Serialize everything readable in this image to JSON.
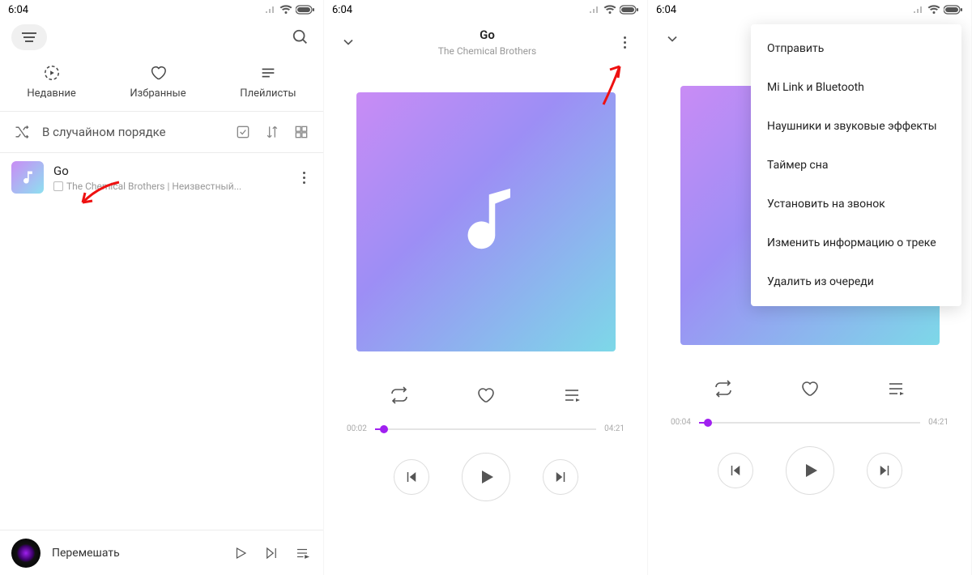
{
  "status": {
    "time": "6:04"
  },
  "screen1": {
    "tabs": {
      "recent": "Недавние",
      "favorites": "Избранные",
      "playlists": "Плейлисты"
    },
    "shuffle_label": "В случайном порядке",
    "track": {
      "title": "Go",
      "subtitle": "The Chemical Brothers | Неизвестный..."
    },
    "bottom_label": "Перемешать"
  },
  "screen2": {
    "title": "Go",
    "artist": "The Chemical Brothers",
    "time_current": "00:02",
    "time_total": "04:21"
  },
  "screen3": {
    "time_current": "00:04",
    "time_total": "04:21",
    "menu": [
      "Отправить",
      "Mi Link и Bluetooth",
      "Наушники и звуковые эффекты",
      "Таймер сна",
      "Установить на звонок",
      "Изменить информацию о треке",
      "Удалить из очереди"
    ]
  }
}
